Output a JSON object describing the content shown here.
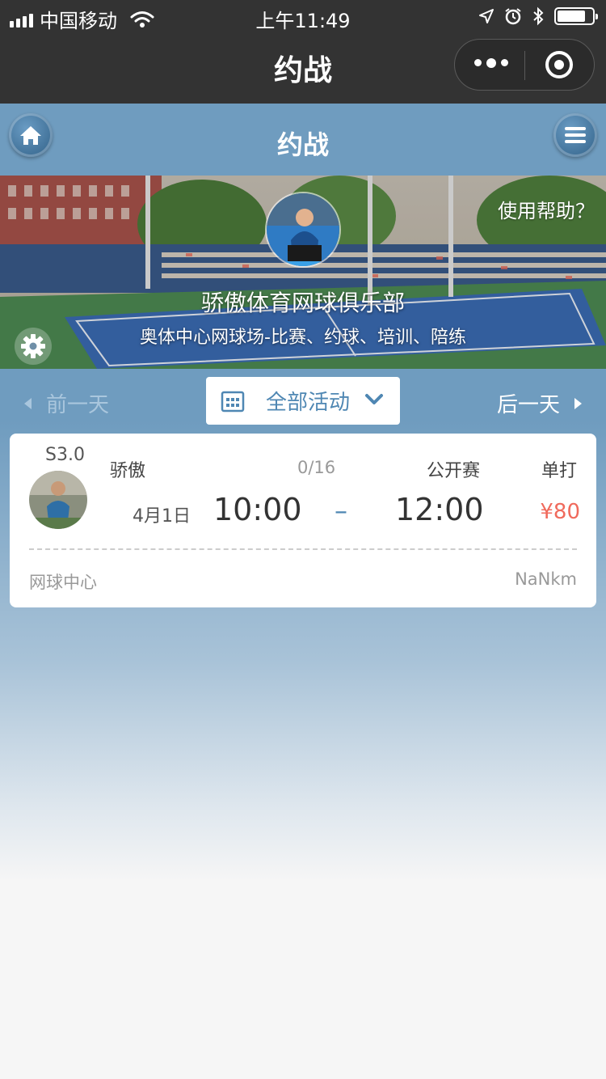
{
  "status_bar": {
    "carrier": "中国移动",
    "time": "上午11:49"
  },
  "nav": {
    "title": "约战"
  },
  "header": {
    "title": "约战"
  },
  "banner": {
    "help_link": "使用帮助？",
    "club_name": "骄傲体育网球俱乐部",
    "club_description": "奥体中心网球场-比赛、约球、培训、陪练"
  },
  "date_switcher": {
    "prev_label": "前一天",
    "next_label": "后一天",
    "filter_selected": "全部活动"
  },
  "activities": [
    {
      "level": "S3.0",
      "organizer": "骄傲",
      "participants": "0/16",
      "match_type": "公开赛",
      "play_type": "单打",
      "date": "4月1日",
      "start_time": "10:00",
      "separator": "–",
      "end_time": "12:00",
      "price": "¥80",
      "venue": "网球中心",
      "distance": "NaNkm"
    }
  ],
  "colors": {
    "top_bar": "#333333",
    "theme_blue": "#6f9cbf",
    "accent_blue": "#4f87b3",
    "price_red": "#f06a5c",
    "page_bg": "#f6f6f6"
  },
  "icons": {
    "home": "home-icon",
    "menu": "hamburger-menu-icon",
    "settings": "gear-icon",
    "calendar": "calendar-icon",
    "filter_chevron": "chevron-down-icon",
    "prev": "triangle-left-icon",
    "next": "triangle-right-icon"
  }
}
